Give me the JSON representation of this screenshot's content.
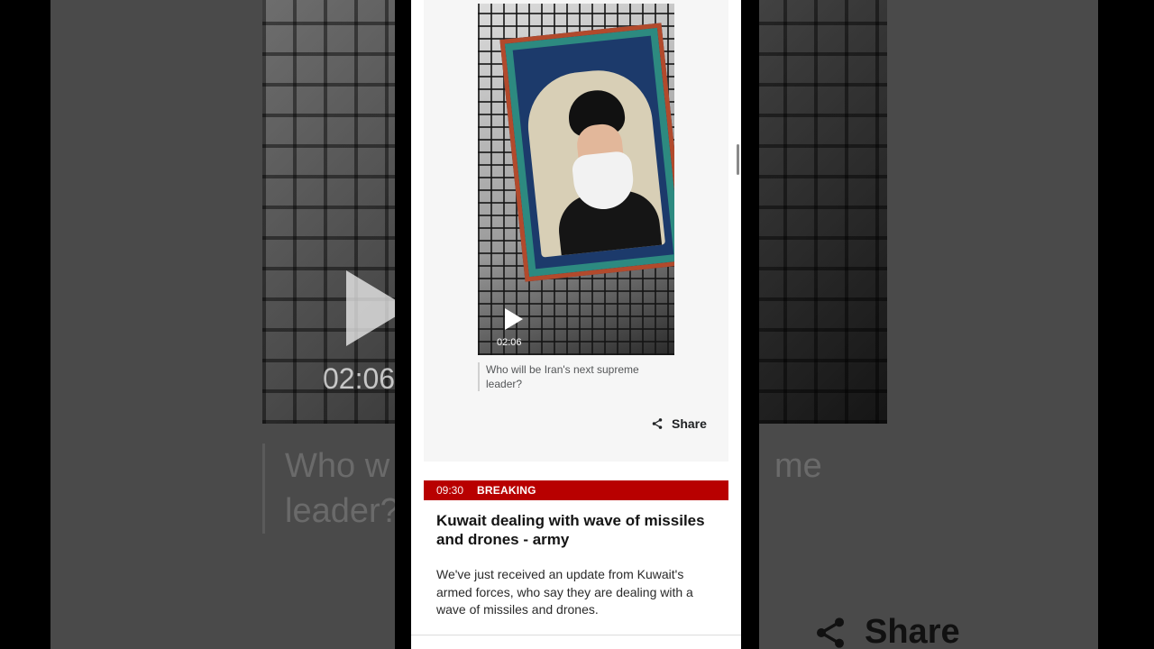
{
  "video": {
    "duration": "02:06",
    "caption": "Who will be Iran's next supreme leader?",
    "bg_caption_line1": "Who w",
    "bg_caption_line1_tail": "me",
    "bg_caption_line2": "leader?",
    "bg_duration": "02:06"
  },
  "share": {
    "label": "Share",
    "icon": "share-icon"
  },
  "post": {
    "time": "09:30",
    "badge": "BREAKING",
    "headline": "Kuwait dealing with wave of missiles and drones - army",
    "body": "We've just received an update from Kuwait's armed forces, who say they are dealing with a wave of missiles and drones."
  },
  "colors": {
    "breaking_red": "#b80000",
    "card_bg": "#f6f6f6",
    "text": "#141414"
  },
  "bg_share_label": "Share"
}
